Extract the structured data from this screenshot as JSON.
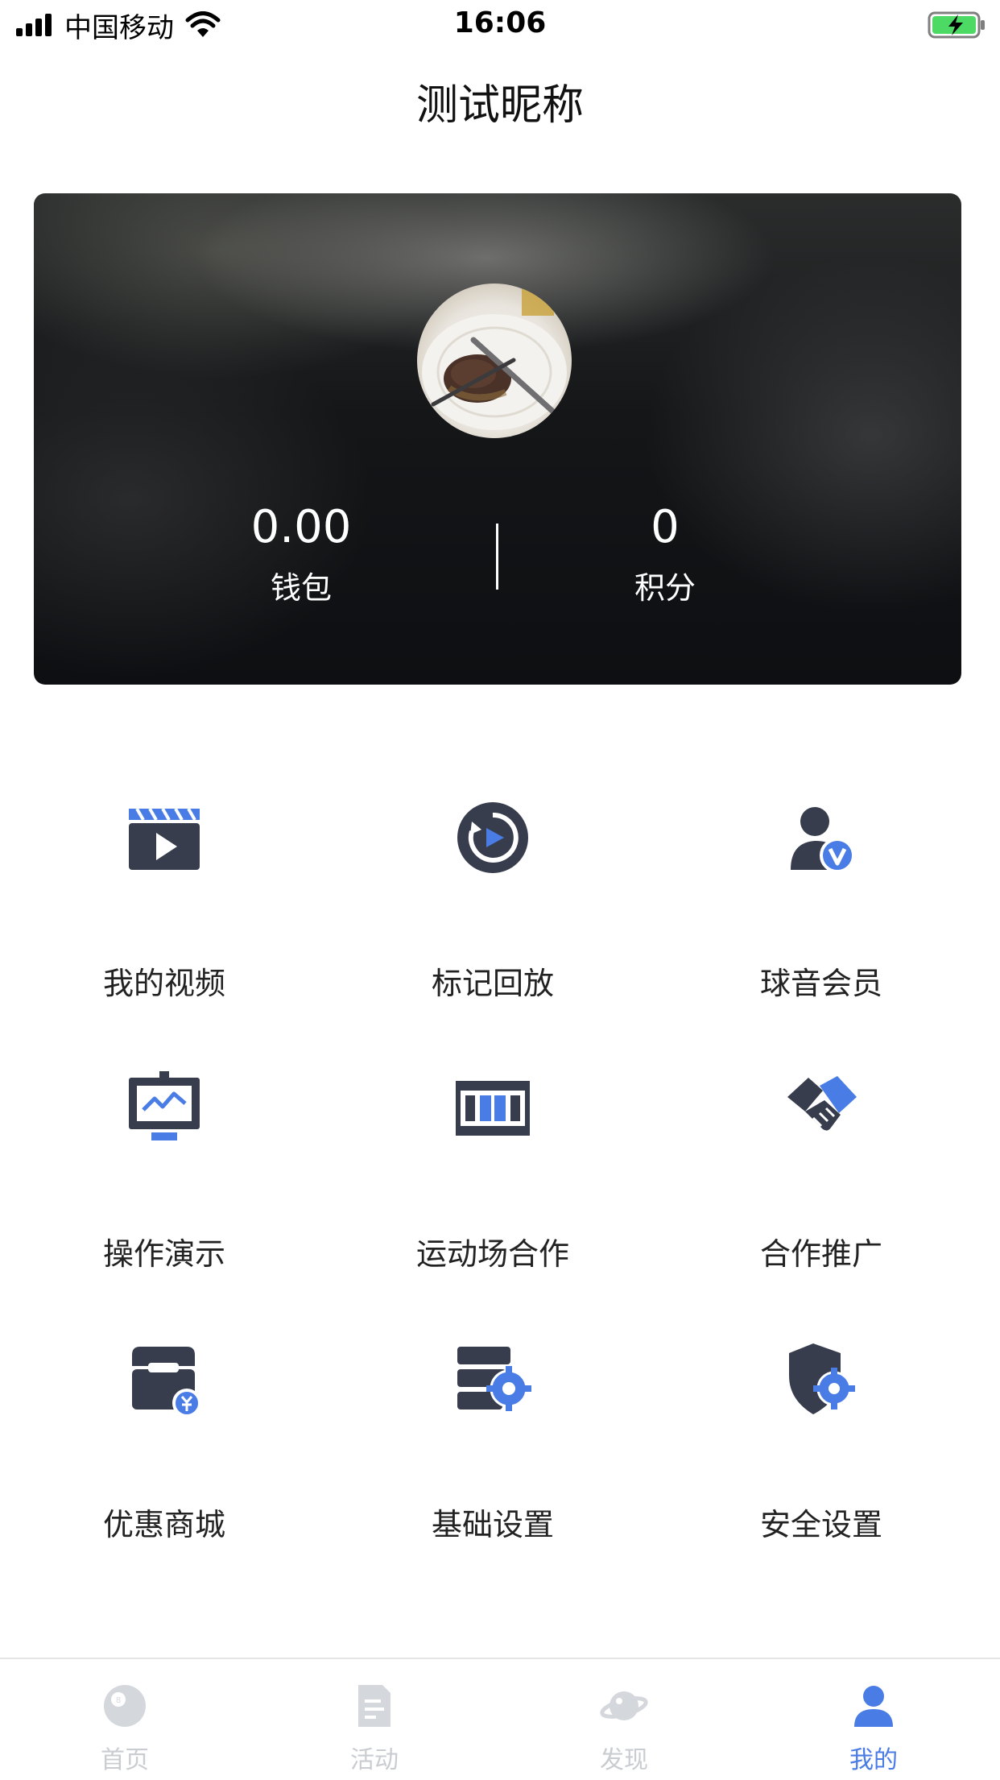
{
  "status_bar": {
    "carrier": "中国移动",
    "time": "16:06"
  },
  "header": {
    "title": "测试昵称"
  },
  "profile": {
    "wallet_value": "0.00",
    "wallet_label": "钱包",
    "points_value": "0",
    "points_label": "积分"
  },
  "menu": {
    "items": [
      {
        "label": "我的视频",
        "icon": "video-clapper-icon"
      },
      {
        "label": "标记回放",
        "icon": "replay-icon"
      },
      {
        "label": "球音会员",
        "icon": "vip-member-icon"
      },
      {
        "label": "操作演示",
        "icon": "presentation-icon"
      },
      {
        "label": "运动场合作",
        "icon": "stadium-icon"
      },
      {
        "label": "合作推广",
        "icon": "handshake-icon"
      },
      {
        "label": "优惠商城",
        "icon": "shop-icon"
      },
      {
        "label": "基础设置",
        "icon": "server-settings-icon"
      },
      {
        "label": "安全设置",
        "icon": "security-settings-icon"
      }
    ]
  },
  "tab_bar": {
    "tabs": [
      {
        "label": "首页",
        "icon": "billiard-ball-icon"
      },
      {
        "label": "活动",
        "icon": "document-icon"
      },
      {
        "label": "发现",
        "icon": "planet-icon"
      },
      {
        "label": "我的",
        "icon": "user-icon"
      }
    ],
    "active_index": 3
  },
  "colors": {
    "accent": "#4a7ce6",
    "icon_dark": "#373d4d",
    "tab_inactive": "#c9ccd1"
  }
}
